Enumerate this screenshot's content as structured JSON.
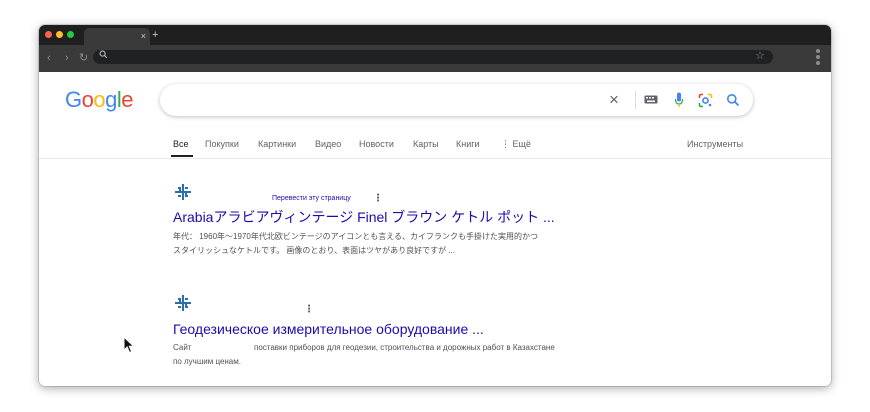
{
  "browser": {
    "tab_close": "×",
    "new_tab": "+",
    "nav_back": "‹",
    "nav_forward": "›",
    "nav_reload": "↻",
    "bookmark_star": "☆"
  },
  "google": {
    "logo_letters": [
      "G",
      "o",
      "o",
      "g",
      "l",
      "e"
    ],
    "logo_colors": [
      "#4285f4",
      "#ea4335",
      "#fbbc05",
      "#4285f4",
      "#34a853",
      "#ea4335"
    ],
    "search_value": "",
    "clear": "×"
  },
  "tabs": {
    "all": "Все",
    "shopping": "Покупки",
    "images": "Картинки",
    "video": "Видео",
    "news": "Новости",
    "maps": "Карты",
    "books": "Книги",
    "more": "⋮ Ещё",
    "tools": "Инструменты"
  },
  "results": [
    {
      "translate": "Перевести эту страницу",
      "menu": "⋮",
      "title": "Arabiaアラビアヴィンテージ Finel ブラウン ケトル ポット ...",
      "snippet_lines": [
        "年代： 1960年〜1970年代北欧ビンテージのアイコンとも言える、カイフランクも手掛けた実用的かつ",
        "スタイリッシュなケトルです。 画像のとおり、表面はツヤがあり良好ですが ..."
      ]
    },
    {
      "menu": "⋮",
      "title": "Геодезическое измерительное оборудование ...",
      "snippet_prefix": "Сайт",
      "snippet_rest": "поставки приборов для геодезии, строительства и дорожных работ в Казахстане",
      "snippet_line2": "по лучшим ценам."
    }
  ],
  "colors": {
    "link": "#1a0dab",
    "favicon": "#2a6fa8"
  }
}
